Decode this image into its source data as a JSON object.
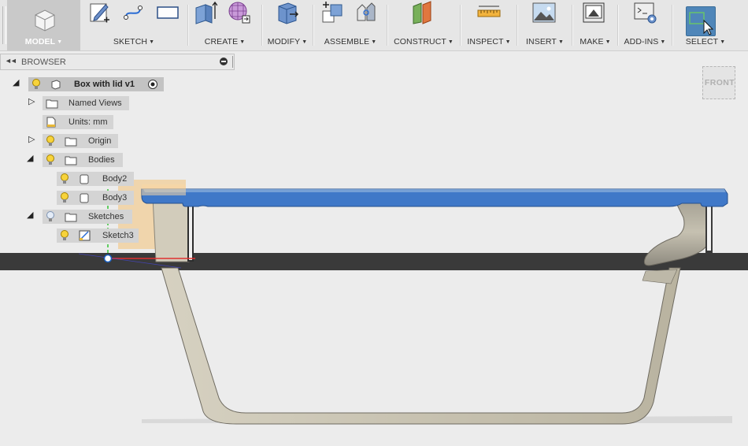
{
  "toolbar": {
    "model_label": "MODEL",
    "sketch_label": "SKETCH",
    "create_label": "CREATE",
    "modify_label": "MODIFY",
    "assemble_label": "ASSEMBLE",
    "construct_label": "CONSTRUCT",
    "inspect_label": "INSPECT",
    "insert_label": "INSERT",
    "make_label": "MAKE",
    "addins_label": "ADD-INS",
    "select_label": "SELECT",
    "caret": "▼"
  },
  "browser": {
    "title": "BROWSER",
    "collapse_glyph": "◄◄",
    "root": "Box with lid v1",
    "items": [
      {
        "label": "Named Views"
      },
      {
        "label": "Units: mm"
      },
      {
        "label": "Origin"
      },
      {
        "label": "Bodies"
      },
      {
        "label": "Body2"
      },
      {
        "label": "Body3"
      },
      {
        "label": "Sketches"
      },
      {
        "label": "Sketch3"
      }
    ]
  },
  "viewcube": {
    "face_label": "FRONT"
  },
  "colors": {
    "lid_blue": "#3f78c8",
    "body_tan": "#c9c3b0",
    "ground_band": "#3a3a3a",
    "select_active": "#4f86b9"
  }
}
